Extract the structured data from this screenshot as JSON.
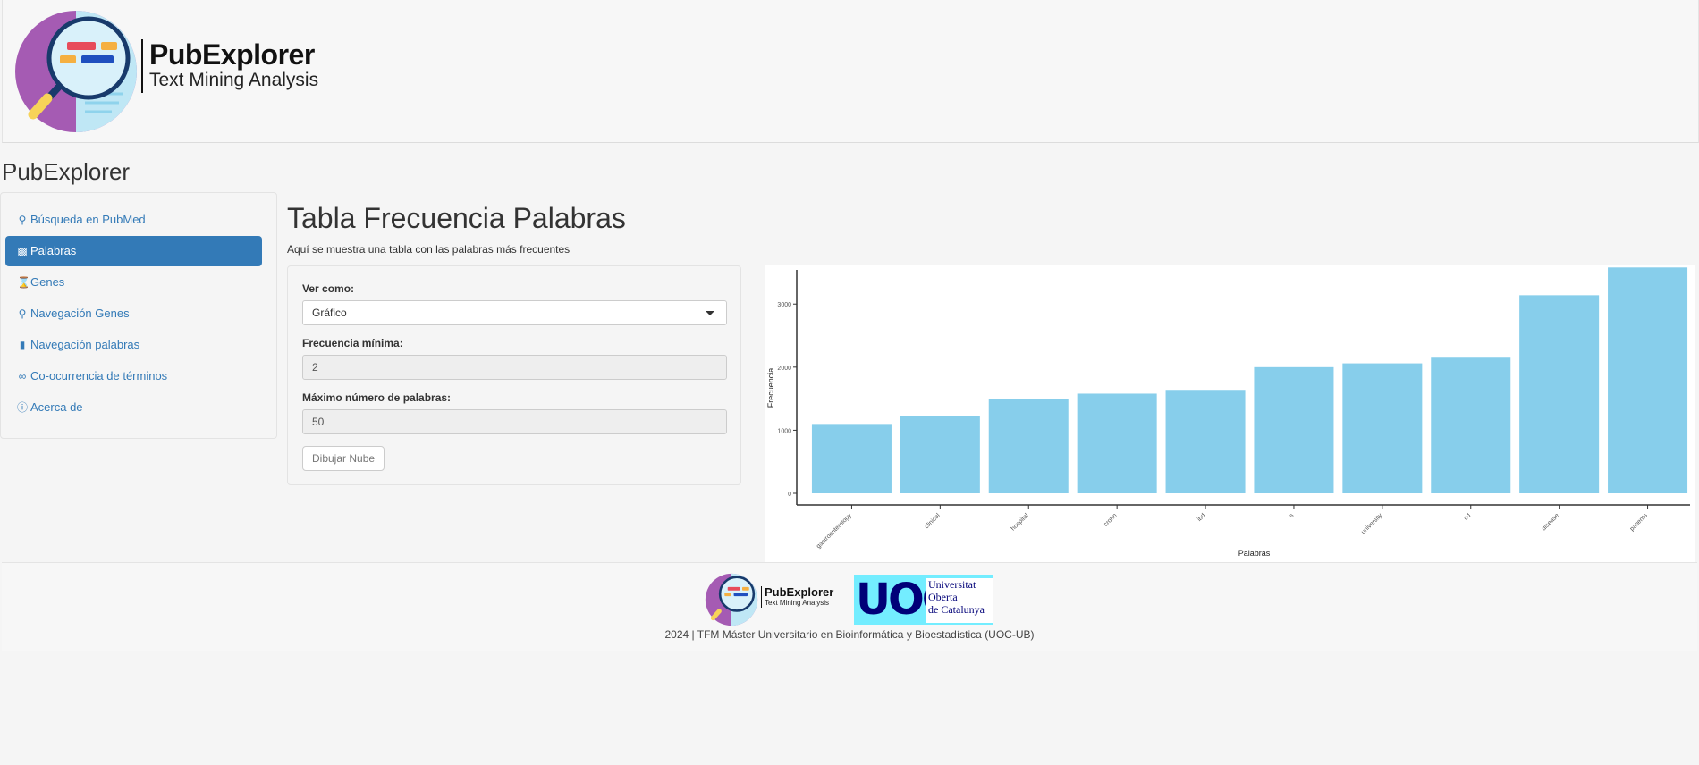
{
  "header": {
    "logo_title": "PubExplorer",
    "logo_subtitle": "Text Mining Analysis"
  },
  "app_title": "PubExplorer",
  "sidebar": {
    "items": [
      {
        "label": "Búsqueda en PubMed",
        "icon": "search-icon",
        "active": false
      },
      {
        "label": "Palabras",
        "icon": "bar-chart-icon",
        "active": true
      },
      {
        "label": "Genes",
        "icon": "hourglass-icon",
        "active": false
      },
      {
        "label": "Navegación Genes",
        "icon": "search-plus-icon",
        "active": false
      },
      {
        "label": "Navegación palabras",
        "icon": "book-icon",
        "active": false
      },
      {
        "label": "Co-ocurrencia de términos",
        "icon": "link-icon",
        "active": false
      },
      {
        "label": "Acerca de",
        "icon": "info-circle-icon",
        "active": false
      }
    ]
  },
  "main": {
    "title": "Tabla Frecuencia Palabras",
    "subtitle": "Aquí se muestra una tabla con las palabras más frecuentes"
  },
  "controls": {
    "view_label": "Ver como:",
    "view_value": "Gráfico",
    "min_freq_label": "Frecuencia mínima:",
    "min_freq_value": "2",
    "max_words_label": "Máximo número de palabras:",
    "max_words_value": "50",
    "draw_button": "Dibujar Nube"
  },
  "chart_data": {
    "type": "bar",
    "categories": [
      "gastroenterology",
      "clinical",
      "hospital",
      "crohn",
      "ibd",
      "s",
      "university",
      "cd",
      "disease",
      "patients"
    ],
    "values": [
      1100,
      1230,
      1500,
      1580,
      1640,
      2000,
      2060,
      2150,
      3140,
      3580
    ],
    "xlabel": "Palabras",
    "ylabel": "Frecuencia",
    "yticks": [
      0,
      1000,
      2000,
      3000
    ],
    "ylim": [
      0,
      3700
    ],
    "color": "#87ceeb",
    "grid": false
  },
  "footer": {
    "logo_title": "PubExplorer",
    "logo_subtitle": "Text Mining Analysis",
    "uoc_mark": "UOC",
    "uoc_line1": "Universitat",
    "uoc_line2": "Oberta",
    "uoc_line3": "de Catalunya",
    "credit": "2024 | TFM Máster Universitario en Bioinformática y Bioestadística (UOC-UB)"
  }
}
